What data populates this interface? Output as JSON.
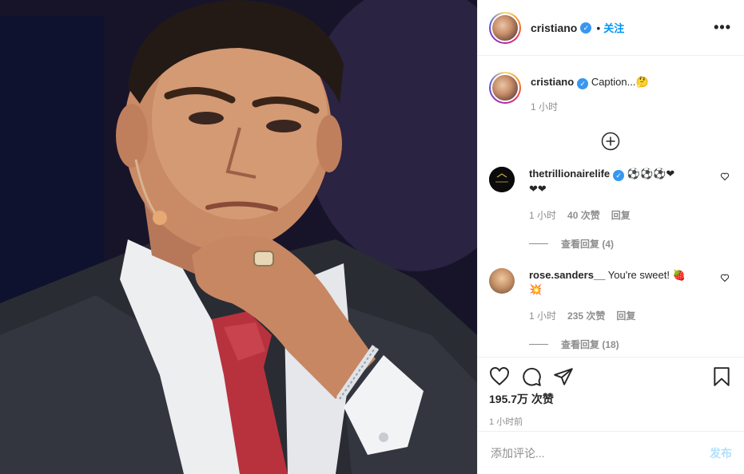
{
  "header": {
    "username": "cristiano",
    "separator": "•",
    "follow_label": "关注",
    "more_label": "•••"
  },
  "caption": {
    "username": "cristiano",
    "text": "Caption...",
    "emoji": "🤔",
    "time": "1 小时"
  },
  "comments": [
    {
      "username": "thetrillionairelife",
      "text": "⚽⚽⚽❤",
      "text_line2": "❤❤",
      "time": "1 小时",
      "likes": "40 次赞",
      "reply_label": "回复",
      "view_replies": "查看回复 (4)"
    },
    {
      "username": "rose.sanders__",
      "text": "You're sweet! 🍓",
      "text_line2": "💥",
      "time": "1 小时",
      "likes": "235 次赞",
      "reply_label": "回复",
      "view_replies": "查看回复 (18)"
    }
  ],
  "post": {
    "likes": "195.7万 次赞",
    "time_ago": "1 小时前"
  },
  "add_comment": {
    "placeholder": "添加评论...",
    "post_label": "发布"
  },
  "icons": {
    "verified": "verified-badge-icon",
    "more": "more-options-icon",
    "load_more": "plus-circle-icon",
    "like": "heart-icon",
    "comment": "comment-bubble-icon",
    "share": "paper-plane-icon",
    "save": "bookmark-icon"
  },
  "colors": {
    "accent": "#0095f6",
    "verified": "#3897f0",
    "muted": "#8e8e8e",
    "post_disabled": "#b2dffc"
  }
}
